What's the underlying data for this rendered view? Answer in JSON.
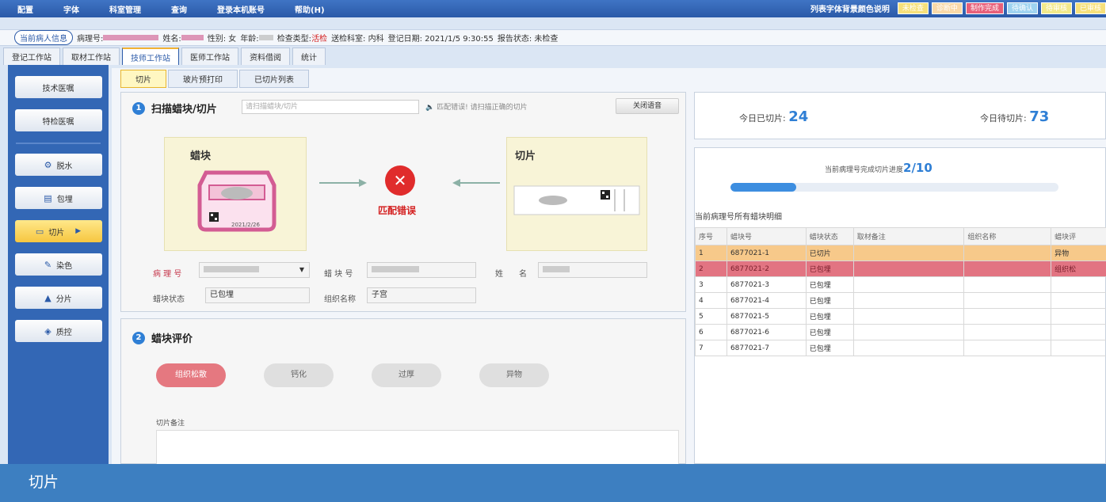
{
  "menu": [
    "配置",
    "字体",
    "科室管理",
    "查询",
    "登录本机账号",
    "帮助(H)"
  ],
  "legend": {
    "title": "列表字体背景颜色说明",
    "chips": [
      {
        "label": "未检查",
        "bg": "#f7e07a"
      },
      {
        "label": "诊断中",
        "bg": "#f9d9a8"
      },
      {
        "label": "制作完成",
        "bg": "#e8607a"
      },
      {
        "label": "待确认",
        "bg": "#9fd3f0"
      },
      {
        "label": "待审核",
        "bg": "#f2e98a"
      },
      {
        "label": "已审核",
        "bg": "#f7e07a"
      }
    ]
  },
  "patient": {
    "pill": "当前病人信息",
    "pathology_no_label": "病理号:",
    "name_label": "姓名:",
    "gender": "性别: 女",
    "age_label": "年龄:",
    "exam_type_label": "检查类型:",
    "exam_type_value": "活检",
    "dept": "送检科室: 内科",
    "reg_date": "登记日期: 2021/1/5 9:30:55",
    "report_status": "报告状态: 未检查"
  },
  "ws_tabs": [
    "登记工作站",
    "取材工作站",
    "技师工作站",
    "医师工作站",
    "资料借阅",
    "统计"
  ],
  "ws_active": 2,
  "sidebar": {
    "top": [
      "技术医嘱",
      "特检医嘱"
    ],
    "items": [
      {
        "label": "脱水",
        "icon": "⚙"
      },
      {
        "label": "包埋",
        "icon": "▤"
      },
      {
        "label": "切片",
        "icon": "▭"
      },
      {
        "label": "染色",
        "icon": "✎"
      },
      {
        "label": "分片",
        "icon": "▲"
      },
      {
        "label": "质控",
        "icon": "◈"
      }
    ],
    "active_index": 2
  },
  "sub_tabs": [
    "切片",
    "玻片预打印",
    "已切片列表"
  ],
  "scan": {
    "num": "1",
    "title": "扫描蜡块/切片",
    "placeholder": "请扫描蜡块/切片",
    "msg": "匹配错误! 请扫描正确的切片",
    "close_voice": "关闭语音",
    "block_label": "蜡块",
    "slide_label": "切片",
    "block_date": "2021/2/26",
    "match_error": "匹配错误",
    "pathology_no_label": "病 理 号",
    "block_no_label": "蜡 块 号",
    "name_label": "姓　　名",
    "block_status_label": "蜡块状态",
    "block_status_value": "已包埋",
    "tissue_label": "组织名称",
    "tissue_value": "子宫"
  },
  "evaluation": {
    "num": "2",
    "title": "蜡块评价",
    "options": [
      "组织松散",
      "钙化",
      "过厚",
      "异物"
    ],
    "active_option": 0,
    "note_label": "切片备注"
  },
  "stats": {
    "cut_today_label": "今日已切片:",
    "cut_today_value": "24",
    "pending_label": "今日待切片:",
    "pending_value": "73"
  },
  "progress": {
    "label": "当前病理号完成切片进度",
    "value": "2/10",
    "fraction": 0.2
  },
  "detail": {
    "title": "当前病理号所有蜡块明细",
    "columns": [
      "序号",
      "蜡块号",
      "蜡块状态",
      "取材备注",
      "组织名称",
      "蜡块评"
    ],
    "rows": [
      [
        "1",
        "6877021-1",
        "已切片",
        "",
        "",
        "异物"
      ],
      [
        "2",
        "6877021-2",
        "已包埋",
        "",
        "",
        "组织松"
      ],
      [
        "3",
        "6877021-3",
        "已包埋",
        "",
        "",
        ""
      ],
      [
        "4",
        "6877021-4",
        "已包埋",
        "",
        "",
        ""
      ],
      [
        "5",
        "6877021-5",
        "已包埋",
        "",
        "",
        ""
      ],
      [
        "6",
        "6877021-6",
        "已包埋",
        "",
        "",
        ""
      ],
      [
        "7",
        "6877021-7",
        "已包埋",
        "",
        "",
        ""
      ]
    ]
  },
  "caption": "切片"
}
